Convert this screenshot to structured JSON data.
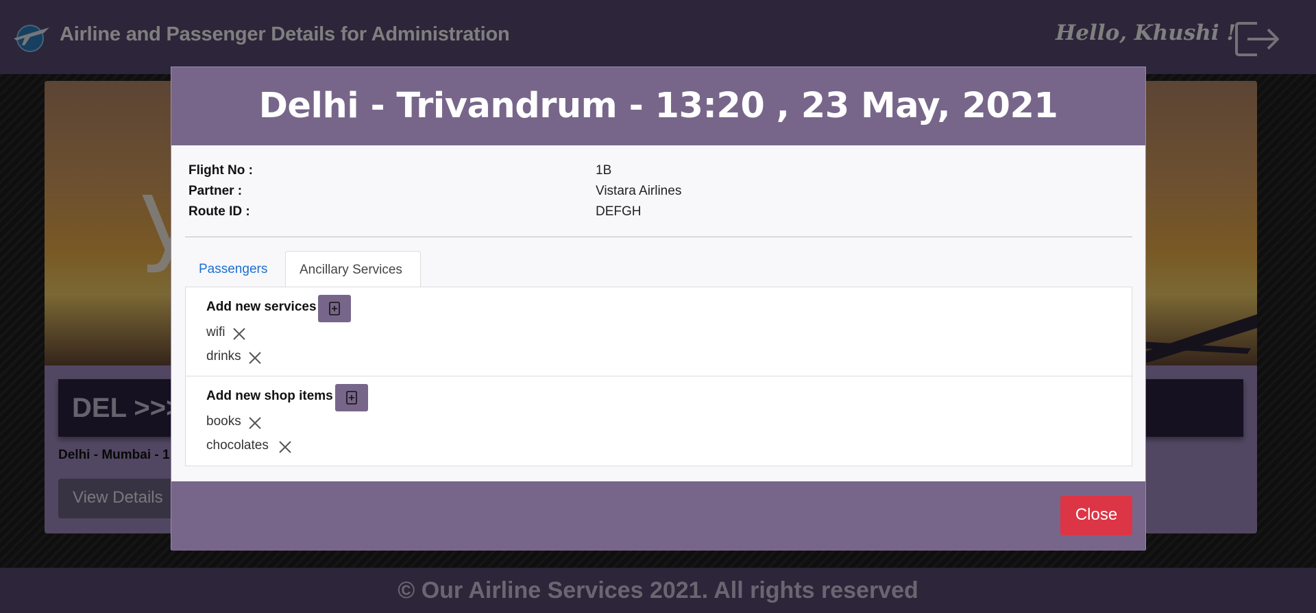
{
  "navbar": {
    "brand": "Airline and Passenger Details for Administration",
    "greeting": "Hello, Khushi !"
  },
  "background_card": {
    "hero_letter": "y",
    "banner": "DEL >>>",
    "route": "Delhi - Mumbai - 1",
    "button": "View Details"
  },
  "footer": {
    "text": "© Our Airline Services 2021. All rights reserved"
  },
  "modal": {
    "title": "Delhi - Trivandrum - 13:20 , 23 May, 2021",
    "info": [
      {
        "label": "Flight No :",
        "value": "1B"
      },
      {
        "label": "Partner :",
        "value": "Vistara Airlines"
      },
      {
        "label": "Route ID :",
        "value": "DEFGH"
      }
    ],
    "tabs": [
      {
        "label": "Passengers",
        "active": false
      },
      {
        "label": "Ancillary Services",
        "active": true
      }
    ],
    "services": {
      "title": "Add new services",
      "items": [
        "wifi",
        "drinks"
      ]
    },
    "shop": {
      "title": "Add new shop items",
      "items": [
        "books",
        "chocolates"
      ]
    },
    "close_label": "Close"
  },
  "colors": {
    "header_purple": "#77668a",
    "close_red": "#dc3545",
    "tab_link_blue": "#1a6fd1"
  }
}
